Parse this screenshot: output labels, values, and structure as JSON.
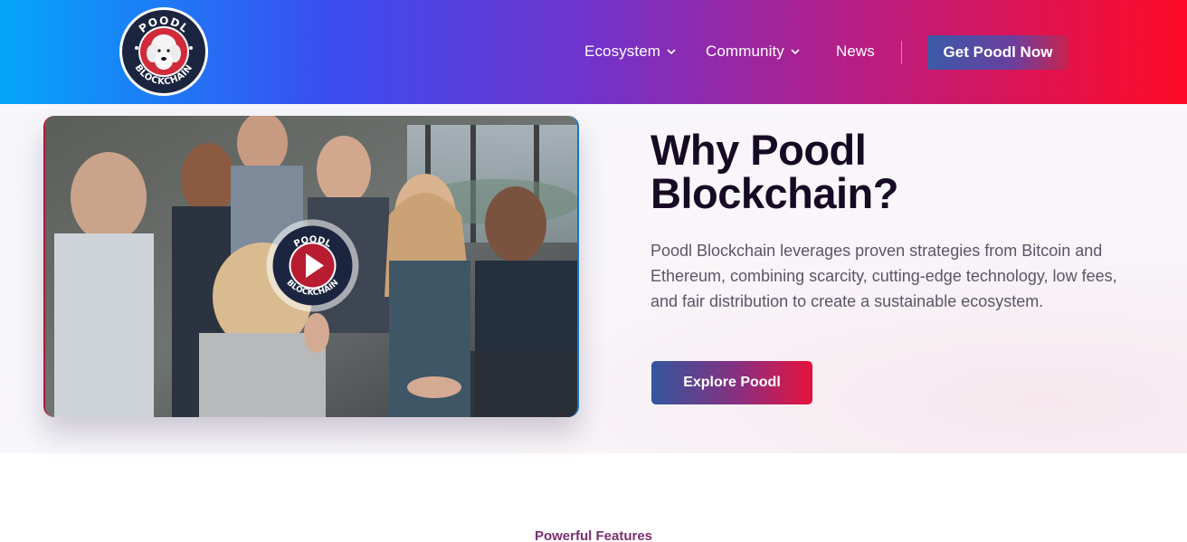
{
  "header": {
    "logo_alt": "POODL BLOCKCHAIN",
    "nav": [
      {
        "label": "Ecosystem",
        "has_dropdown": true
      },
      {
        "label": "Community",
        "has_dropdown": true
      },
      {
        "label": "News",
        "has_dropdown": false
      }
    ],
    "cta_label": "Get Poodl Now"
  },
  "hero": {
    "title_line1": "Why Poodl",
    "title_line2": "Blockchain?",
    "description": "Poodl Blockchain leverages proven strategies from Bitcoin and Ethereum, combining scarcity, cutting-edge technology, low fees, and fair distribution to create a sustainable ecosystem.",
    "cta_label": "Explore Poodl",
    "video": {
      "play_icon": "play-icon",
      "badge_text_top": "POODL",
      "badge_text_bottom": "BLOCKCHAIN"
    }
  },
  "features": {
    "kicker": "Powerful Features"
  },
  "colors": {
    "gradient_start": "#04a6fb",
    "gradient_mid": "#7233cb",
    "gradient_end": "#ff0a26",
    "title_color": "#170a24",
    "text_color": "#5b5566"
  }
}
